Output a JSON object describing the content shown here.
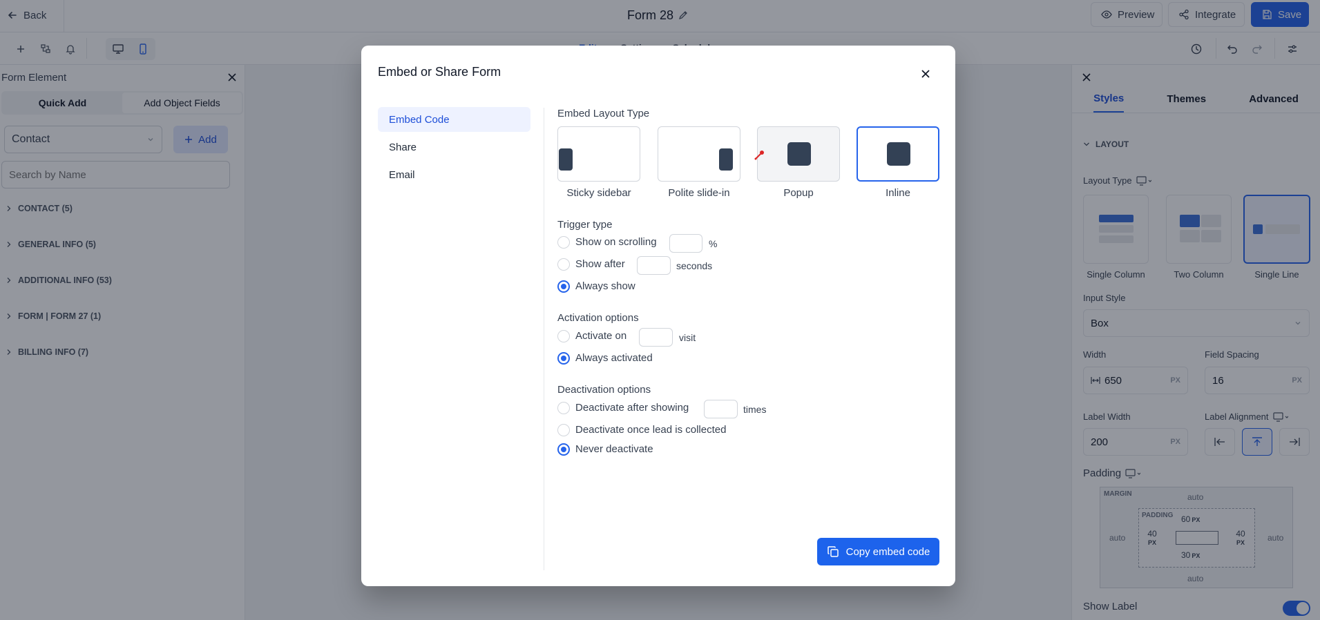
{
  "topbar": {
    "back_label": "Back",
    "form_title": "Form 28",
    "preview_label": "Preview",
    "integrate_label": "Integrate",
    "save_label": "Save"
  },
  "subbar": {
    "tabs": [
      "Editor",
      "Settings",
      "Schedule"
    ]
  },
  "left_panel": {
    "title": "Form Element",
    "tabs": [
      "Quick Add",
      "Add Object Fields"
    ],
    "object_select": "Contact",
    "add_label": "Add",
    "search_placeholder": "Search by Name",
    "sections": [
      "CONTACT (5)",
      "GENERAL INFO (5)",
      "ADDITIONAL INFO (53)",
      "FORM | FORM 27 (1)",
      "BILLING INFO (7)"
    ]
  },
  "right_panel": {
    "tabs": [
      "Styles",
      "Themes",
      "Advanced"
    ],
    "layout_heading": "LAYOUT",
    "layout_type_label": "Layout Type",
    "layout_options": [
      "Single Column",
      "Two Column",
      "Single Line"
    ],
    "input_style_label": "Input Style",
    "input_style_value": "Box",
    "width_label": "Width",
    "width_value": "650",
    "field_spacing_label": "Field Spacing",
    "field_spacing_value": "16",
    "label_width_label": "Label Width",
    "label_width_value": "200",
    "label_alignment_label": "Label Alignment",
    "px_unit": "PX",
    "padding_label": "Padding",
    "margin_label": "MARGIN",
    "margin_auto": "auto",
    "padding_inner_label": "PADDING",
    "padding_top": "60",
    "padding_left": "40",
    "padding_right": "40",
    "padding_bottom": "30",
    "show_label": "Show Label"
  },
  "modal": {
    "title": "Embed or Share Form",
    "nav": [
      "Embed Code",
      "Share",
      "Email"
    ],
    "layout_type_label": "Embed Layout Type",
    "layout_types": [
      "Sticky sidebar",
      "Polite slide-in",
      "Popup",
      "Inline"
    ],
    "trigger_label": "Trigger type",
    "trigger_options": [
      "Show on scrolling",
      "Show after",
      "Always show"
    ],
    "percent_unit": "%",
    "seconds_unit": "seconds",
    "activation_label": "Activation options",
    "activation_options": [
      "Activate on",
      "Always activated"
    ],
    "visit_unit": "visit",
    "deactivation_label": "Deactivation options",
    "deactivation_options": [
      "Deactivate after showing",
      "Deactivate once lead is collected",
      "Never deactivate"
    ],
    "times_unit": "times",
    "copy_button": "Copy embed code"
  },
  "colors": {
    "accent": "#2563eb",
    "overlay": "#111827",
    "placeholder_block": "#334155"
  }
}
